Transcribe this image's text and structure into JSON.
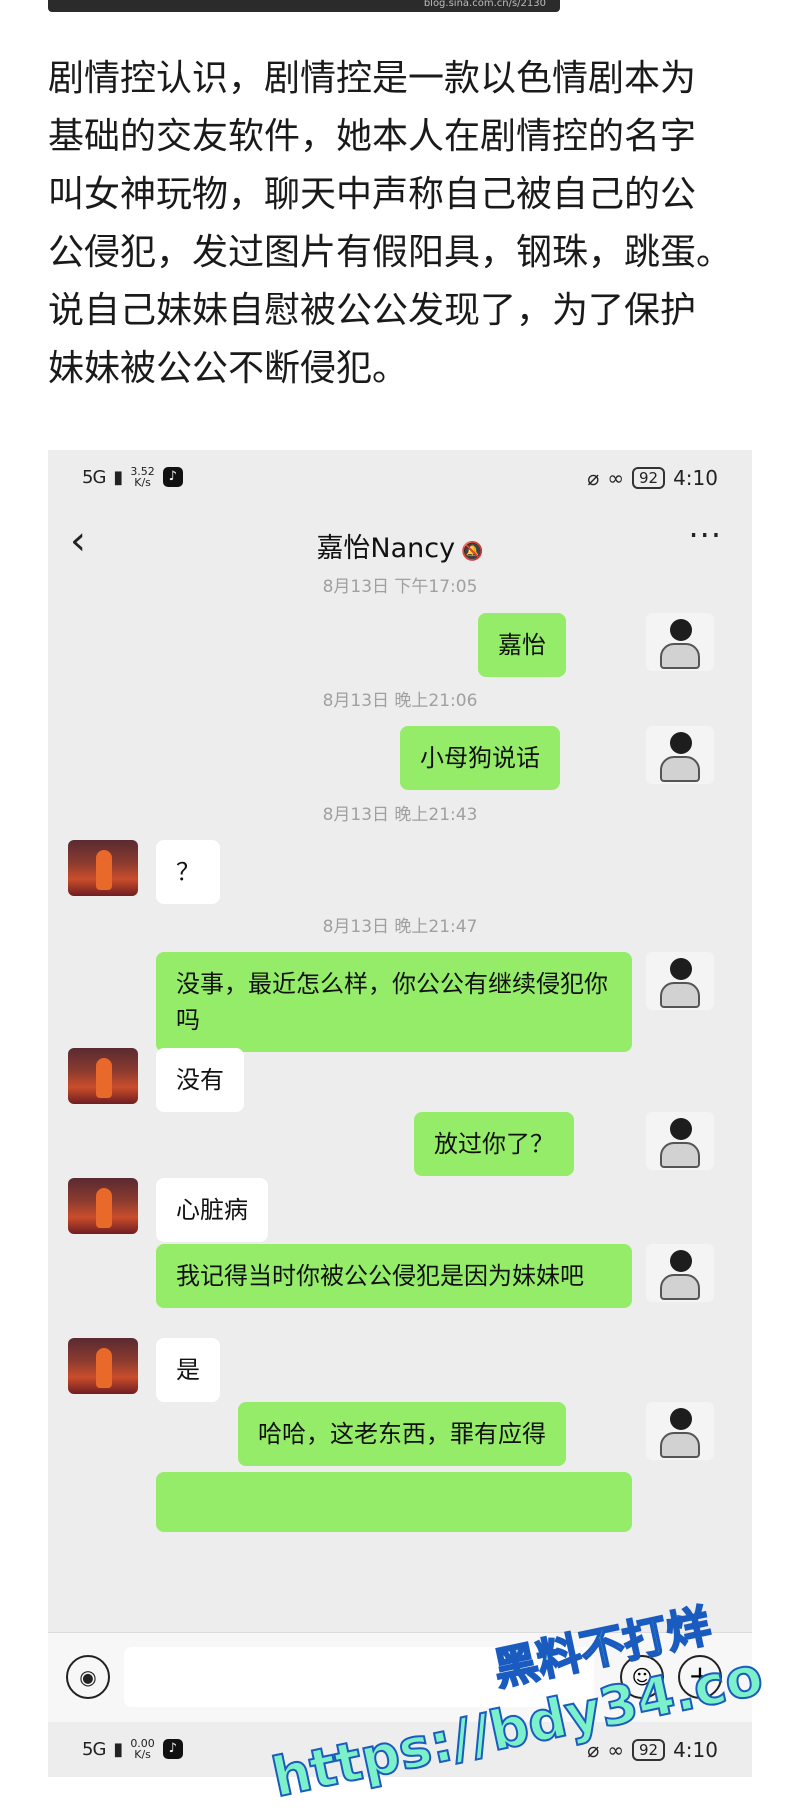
{
  "article": {
    "lines": [
      "剧情控认识，剧情控是一款以色情剧本为",
      "基础的交友软件，她本人在剧情控的名字",
      "叫女神玩物，聊天中声称自己被自己的公",
      "公侵犯，发过图片有假阳具，钢珠，跳蛋。",
      "说自己妹妹自慰被公公发现了，为了保护",
      "妹妹被公公不断侵犯。"
    ]
  },
  "status_bar": {
    "signal": "5G",
    "speed_top": "3.52",
    "speed_unit": "K/s",
    "battery": "92",
    "time": "4:10"
  },
  "status_bar_2": {
    "signal": "5G",
    "speed_top": "0.00",
    "speed_unit": "K/s",
    "battery": "92",
    "time": "4:10"
  },
  "chat": {
    "contact_name": "嘉怡Nancy",
    "back_glyph": "‹",
    "more_glyph": "···",
    "timestamps": [
      "8月13日 下午17:05",
      "8月13日 晚上21:06",
      "8月13日 晚上21:43",
      "8月13日 晚上21:47"
    ],
    "messages": [
      {
        "from": "me",
        "text": "嘉怡"
      },
      {
        "from": "me",
        "text": "小母狗说话"
      },
      {
        "from": "other",
        "text": "？"
      },
      {
        "from": "me",
        "text": "没事，最近怎么样，你公公有继续侵犯你吗"
      },
      {
        "from": "other",
        "text": "没有"
      },
      {
        "from": "me",
        "text": "放过你了？"
      },
      {
        "from": "other",
        "text": "心脏病"
      },
      {
        "from": "me",
        "text": "我记得当时你被公公侵犯是因为妹妹吧"
      },
      {
        "from": "other",
        "text": "是"
      },
      {
        "from": "me",
        "text": "哈哈，这老东西，罪有应得"
      }
    ]
  },
  "watermark": {
    "line1": "黑料不打烊",
    "line2": "https://bdy34.co"
  },
  "top_strip_text": "blog.sina.com.cn/s/2130",
  "colors": {
    "bubble_me": "#95ec69",
    "bubble_other": "#ffffff",
    "chat_background": "#ededed"
  }
}
